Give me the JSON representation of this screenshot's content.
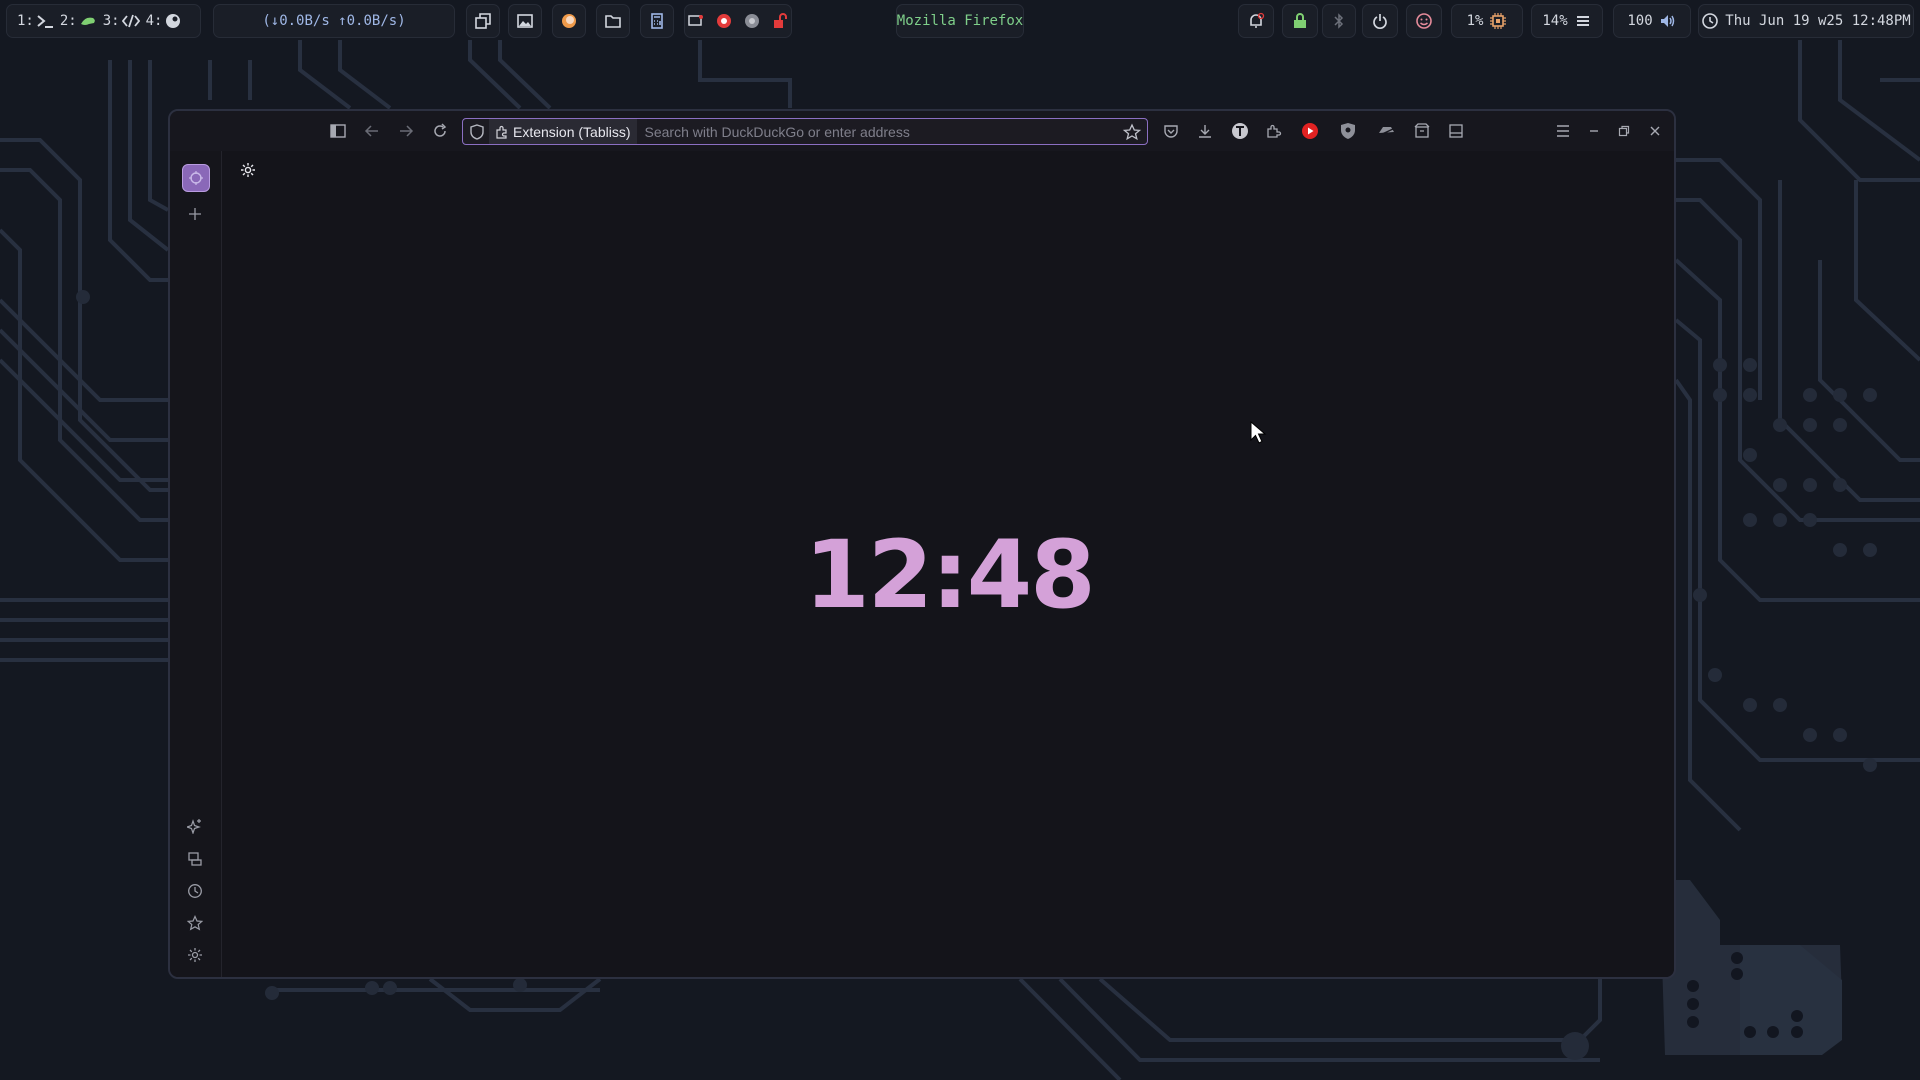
{
  "topbar": {
    "workspaces": [
      {
        "num": "1:",
        "icon": "terminal-prompt-icon"
      },
      {
        "num": "2:",
        "icon": "chameleon-icon"
      },
      {
        "num": "3:",
        "icon": "code-brackets-icon"
      },
      {
        "num": "4:",
        "icon": "steam-icon"
      }
    ],
    "network": "(↓0.0B/s ↑0.0B/s)",
    "window_title": "Mozilla Firefox",
    "cpu": "1%",
    "memory": "14%",
    "volume": "100",
    "datetime": "Thu Jun 19 w25 12:48PM"
  },
  "browser": {
    "url_chip_label": "Extension (Tabliss)",
    "url_placeholder": "Search with DuckDuckGo or enter address",
    "clock_time": "12:48"
  },
  "colors": {
    "accent": "#d4a1d8",
    "urlbar_focus": "#8b6fc2",
    "cpu_icon": "#e8a26a",
    "lock_icon": "#7fcf72",
    "record_red": "#e33b3b"
  }
}
